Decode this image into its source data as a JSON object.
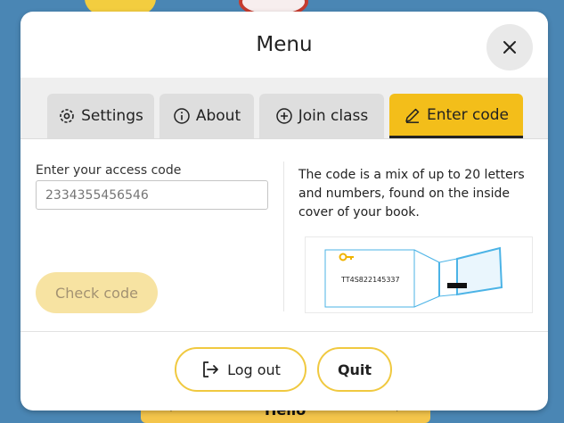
{
  "modal": {
    "title": "Menu"
  },
  "tabs": [
    {
      "label": "Settings",
      "icon": "gear-icon",
      "active": false
    },
    {
      "label": "About",
      "icon": "info-icon",
      "active": false
    },
    {
      "label": "Join class",
      "icon": "plus-circle-icon",
      "active": false
    },
    {
      "label": "Enter code",
      "icon": "pencil-icon",
      "active": true
    }
  ],
  "enter_code": {
    "field_label": "Enter your access code",
    "input_placeholder": "2334355456546",
    "input_value": "",
    "check_button_label": "Check code",
    "help_text": "The code is a mix of up to 20 letters and numbers, found on the inside cover of your book.",
    "diagram_sample_code": "TT4S822145337"
  },
  "footer": {
    "logout_label": "Log out",
    "quit_label": "Quit"
  },
  "background": {
    "bottom_label": "Hello"
  },
  "colors": {
    "accent": "#f3be1a",
    "diagram_line": "#4bb3e6",
    "disabled_button": "#f7e3a2"
  }
}
